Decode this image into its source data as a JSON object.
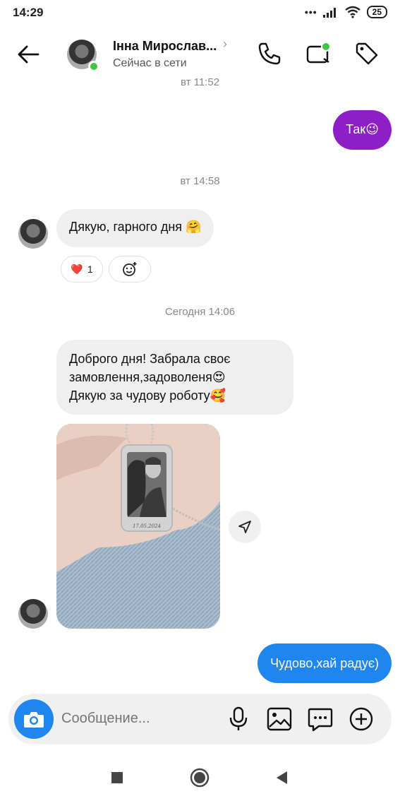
{
  "status": {
    "time": "14:29",
    "battery": "25"
  },
  "header": {
    "contact_name": "Інна Мирослав...",
    "contact_status": "Сейчас в сети"
  },
  "timestamps": {
    "partial": "вт 11:52",
    "t1": "вт 14:58",
    "t2": "Сегодня 14:06"
  },
  "messages": [
    {
      "from": "me",
      "text": "Так😉"
    },
    {
      "from": "them",
      "text": "Дякую, гарного дня 🤗"
    },
    {
      "from": "them",
      "lines": [
        "Доброго дня! Забрала своє",
        "замовлення,задоволеня😍",
        "Дякую за чудову роботу🥰"
      ]
    },
    {
      "from": "me",
      "text": "Чудово,хай радує)"
    }
  ],
  "reaction": {
    "emoji": "❤️",
    "count": "1"
  },
  "photo": {
    "engraving_date": "17.05.2024"
  },
  "composer": {
    "placeholder": "Сообщение..."
  },
  "colors": {
    "purple_bubble": "#8e1fc7",
    "blue_bubble": "#1f86f0",
    "incoming_bubble": "#efefef",
    "online": "#3ec73e"
  }
}
